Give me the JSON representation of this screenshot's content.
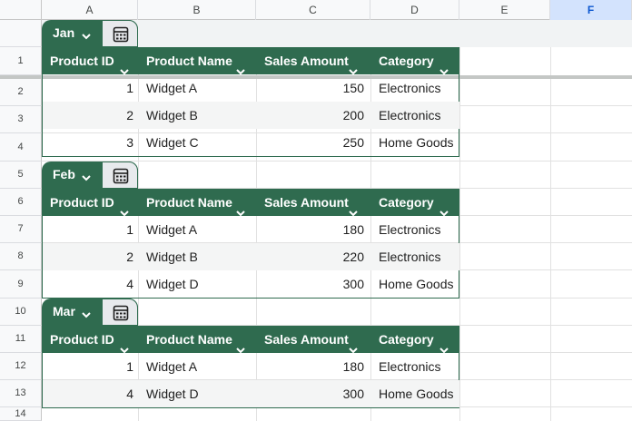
{
  "columns": [
    "",
    "A",
    "B",
    "C",
    "D",
    "E",
    "F"
  ],
  "rows": [
    "1",
    "2",
    "3",
    "4",
    "5",
    "6",
    "7",
    "8",
    "9",
    "10",
    "11",
    "12",
    "13",
    "14"
  ],
  "headers": [
    "Product ID",
    "Product Name",
    "Sales Amount",
    "Category"
  ],
  "tables": [
    {
      "name": "Jan",
      "rows": [
        {
          "id": "1",
          "name": "Widget A",
          "amount": "150",
          "category": "Electronics"
        },
        {
          "id": "2",
          "name": "Widget B",
          "amount": "200",
          "category": "Electronics"
        },
        {
          "id": "3",
          "name": "Widget C",
          "amount": "250",
          "category": "Home Goods"
        }
      ]
    },
    {
      "name": "Feb",
      "rows": [
        {
          "id": "1",
          "name": "Widget A",
          "amount": "180",
          "category": "Electronics"
        },
        {
          "id": "2",
          "name": "Widget B",
          "amount": "220",
          "category": "Electronics"
        },
        {
          "id": "4",
          "name": "Widget D",
          "amount": "300",
          "category": "Home Goods"
        }
      ]
    },
    {
      "name": "Mar",
      "rows": [
        {
          "id": "1",
          "name": "Widget A",
          "amount": "180",
          "category": "Electronics"
        },
        {
          "id": "4",
          "name": "Widget D",
          "amount": "300",
          "category": "Home Goods"
        }
      ]
    }
  ],
  "colors": {
    "table_header": "#2f6b4f",
    "selected_column": "#d3e3fd"
  },
  "icons": {
    "dropdown": "chevron-down-icon",
    "table_tools": "calculator-icon"
  },
  "selected_column": "F"
}
